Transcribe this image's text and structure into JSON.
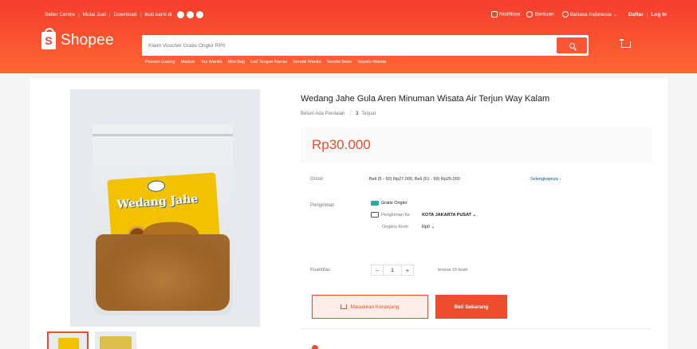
{
  "topbar": {
    "left": [
      "Seller Centre",
      "Mulai Jual",
      "Download",
      "Ikuti kami di"
    ],
    "social_icons": [
      "facebook-icon",
      "instagram-icon",
      "line-icon"
    ],
    "right": {
      "notifications": "Notifikasi",
      "help": "Bantuan",
      "language": "Bahasa Indonesia",
      "signup": "Daftar",
      "login": "Log In"
    }
  },
  "brand": {
    "logo_letter": "S",
    "name": "Shopee"
  },
  "search": {
    "placeholder": "Klaim Voucher Gratis Ongkir RP0"
  },
  "suggestions": [
    "Pemain Gasing",
    "Masker",
    "Tas Wanita",
    "Mini Bag",
    "Led Tangan Nanas",
    "Sendal Wanita",
    "Sendal Bebe",
    "Sepatu Wanita"
  ],
  "product": {
    "title": "Wedang Jahe Gula Aren Minuman Wisata Air Terjun Way Kalam",
    "rating_text": "Belum Ada Penilaian",
    "sold_text": "Terjual",
    "sold_count": "3",
    "price": "Rp30.000",
    "image_label_text": "Wedang Jahe"
  },
  "details": {
    "grosir_label": "Grosir",
    "grosir_text": "Beli (5 - 50) Rp27.000, Beli (51 - 99) Rp25.000",
    "grosir_more": "Selengkapnya",
    "shipping_label": "Pengiriman",
    "free_shipping": "Gratis Ongkir",
    "ship_to_label": "Pengiriman Ke",
    "ship_to_value": "KOTA JAKARTA PUSAT",
    "ship_cost_label": "Ongkos Kirim",
    "ship_cost_value": "Rp0",
    "qty_label": "Kuantitas",
    "qty_value": "1",
    "qty_minus": "−",
    "qty_plus": "+",
    "stock_text": "tersisa 19 buah"
  },
  "actions": {
    "add_to_cart": "Masukkan Keranjang",
    "buy_now": "Beli Sekarang"
  }
}
